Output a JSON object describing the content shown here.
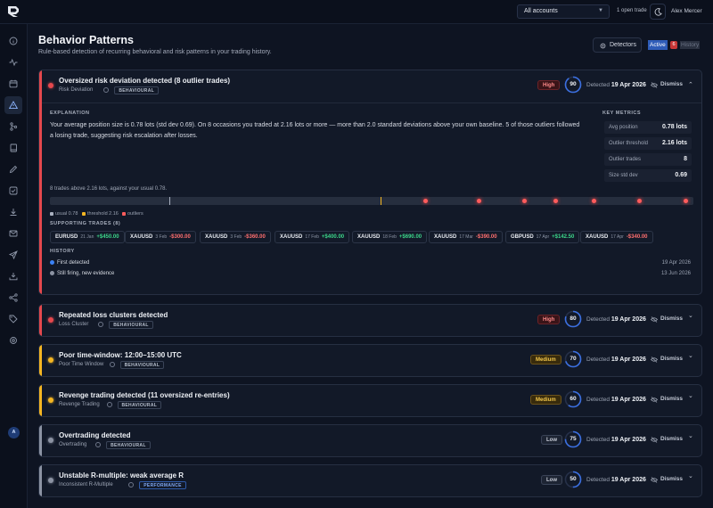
{
  "header": {
    "account_select": "All accounts",
    "open_trades": "1 open trade",
    "user_name": "Alex Mercer"
  },
  "sidebar": {
    "icons": [
      "info-icon",
      "activity-icon",
      "calendar-icon",
      "alert-triangle-icon",
      "split-icon",
      "book-icon",
      "pencil-icon",
      "checklist-icon",
      "download-icon",
      "mail-icon",
      "send-icon",
      "inbox-icon",
      "share-icon",
      "tag-icon",
      "settings-icon"
    ],
    "active_index": 3,
    "avatar_initial": "A"
  },
  "page": {
    "title": "Behavior Patterns",
    "subtitle": "Rule-based detection of recurring behavioral and risk patterns in your trading history.",
    "detectors_label": "Detectors",
    "tab_active": "Active",
    "tab_active_count": "6",
    "tab_history": "History"
  },
  "labels": {
    "detected": "Detected",
    "dismiss": "Dismiss",
    "explanation": "EXPLANATION",
    "key_metrics": "KEY METRICS",
    "supporting_trades": "SUPPORTING TRADES (8)",
    "history": "HISTORY"
  },
  "colors": {
    "high": "#e5484d",
    "medium": "#f5b622",
    "low": "#8c93a3",
    "ring": "#3b6fe0"
  },
  "patterns": [
    {
      "title": "Oversized risk deviation detected (8 outlier trades)",
      "detector": "Risk Deviation",
      "category": "BEHAVIOURAL",
      "severity": "High",
      "level": "high",
      "score": 90,
      "date": "19 Apr 2026",
      "expanded": true
    },
    {
      "title": "Repeated loss clusters detected",
      "detector": "Loss Cluster",
      "category": "BEHAVIOURAL",
      "severity": "High",
      "level": "high",
      "score": 80,
      "date": "19 Apr 2026",
      "expanded": false
    },
    {
      "title": "Poor time-window: 12:00–15:00 UTC",
      "detector": "Poor Time Window",
      "category": "BEHAVIOURAL",
      "severity": "Medium",
      "level": "medium",
      "score": 70,
      "date": "19 Apr 2026",
      "expanded": false
    },
    {
      "title": "Revenge trading detected (11 oversized re-entries)",
      "detector": "Revenge Trading",
      "category": "BEHAVIOURAL",
      "severity": "Medium",
      "level": "medium",
      "score": 60,
      "date": "19 Apr 2026",
      "expanded": false
    },
    {
      "title": "Overtrading detected",
      "detector": "Overtrading",
      "category": "BEHAVIOURAL",
      "severity": "Low",
      "level": "low",
      "score": 75,
      "date": "19 Apr 2026",
      "expanded": false
    },
    {
      "title": "Unstable R-multiple: weak average R",
      "detector": "Inconsistent R-Multiple",
      "category": "PERFORMANCE",
      "severity": "Low",
      "level": "low",
      "score": 50,
      "date": "19 Apr 2026",
      "expanded": false
    }
  ],
  "detail": {
    "explanation": "Your average position size is 0.78 lots (std dev 0.69). On 8 occasions you traded at 2.16 lots or more — more than 2.0 standard deviations above your own baseline. 5 of those outliers followed a losing trade, suggesting risk escalation after losses.",
    "metrics": [
      {
        "label": "Avg position",
        "value": "0.78 lots"
      },
      {
        "label": "Outlier threshold",
        "value": "2.16 lots"
      },
      {
        "label": "Outlier trades",
        "value": "8"
      },
      {
        "label": "Size std dev",
        "value": "0.69"
      }
    ],
    "track_caption": "8 trades above 2.16 lots, against your usual 0.78.",
    "track": {
      "min": 0,
      "max": 4.2,
      "usual": 0.78,
      "threshold": 2.16,
      "outliers": [
        2.16,
        2.45,
        2.8,
        3.1,
        3.3,
        3.55,
        3.85,
        4.15
      ]
    },
    "legend": {
      "usual": "usual 0.78",
      "threshold": "threshold 2.16",
      "outliers": "outliers"
    },
    "trades": [
      {
        "symbol": "EURUSD",
        "date": "21 Jan",
        "pnl": "+$450.00",
        "positive": true
      },
      {
        "symbol": "XAUUSD",
        "date": "3 Feb",
        "pnl": "-$300.00",
        "positive": false
      },
      {
        "symbol": "XAUUSD",
        "date": "3 Feb",
        "pnl": "-$360.00",
        "positive": false
      },
      {
        "symbol": "XAUUSD",
        "date": "17 Feb",
        "pnl": "+$400.00",
        "positive": true
      },
      {
        "symbol": "XAUUSD",
        "date": "18 Feb",
        "pnl": "+$690.00",
        "positive": true
      },
      {
        "symbol": "XAUUSD",
        "date": "17 Mar",
        "pnl": "-$390.00",
        "positive": false
      },
      {
        "symbol": "GBPUSD",
        "date": "17 Apr",
        "pnl": "+$142.50",
        "positive": true
      },
      {
        "symbol": "XAUUSD",
        "date": "17 Apr",
        "pnl": "-$340.00",
        "positive": false
      }
    ],
    "history": [
      {
        "label": "First detected",
        "date": "19 Apr 2026",
        "color": "#3b82f6"
      },
      {
        "label": "Still firing, new evidence",
        "date": "13 Jun 2026",
        "color": "#8c93a3"
      }
    ]
  }
}
